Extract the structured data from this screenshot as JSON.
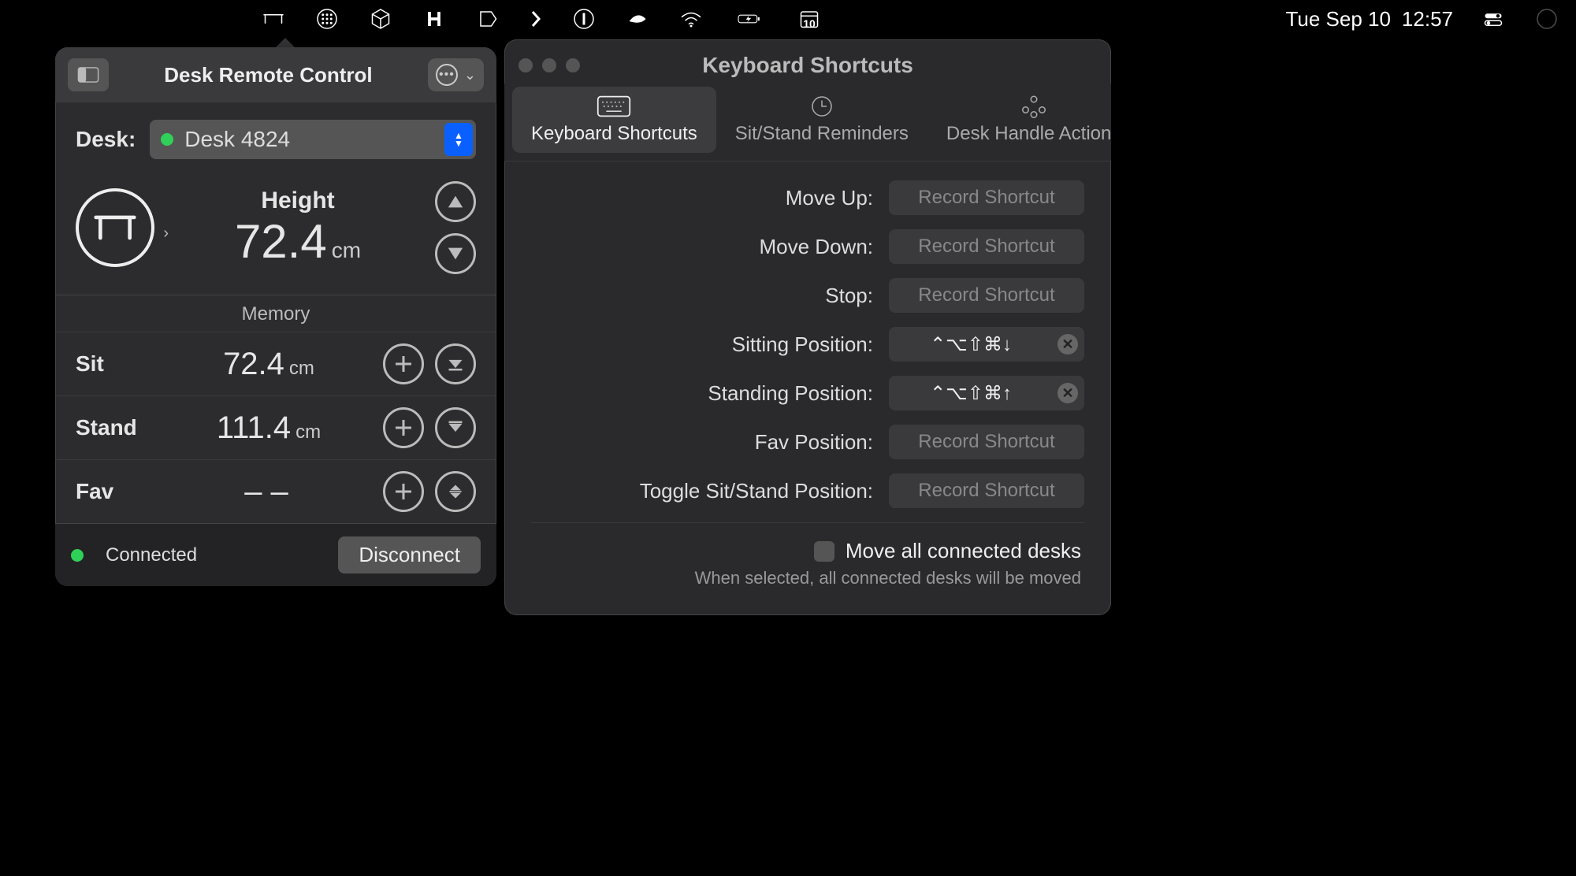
{
  "menubar": {
    "date": "Tue Sep 10",
    "time": "12:57",
    "calendar_badge": "10"
  },
  "popover": {
    "title": "Desk Remote Control",
    "desk_label": "Desk:",
    "desk_name": "Desk 4824",
    "height_label": "Height",
    "height_value": "72.4",
    "height_unit": "cm",
    "memory_title": "Memory",
    "rows": [
      {
        "label": "Sit",
        "value": "72.4",
        "unit": "cm"
      },
      {
        "label": "Stand",
        "value": "111.4",
        "unit": "cm"
      },
      {
        "label": "Fav",
        "value": "– –",
        "unit": ""
      }
    ],
    "connected_label": "Connected",
    "disconnect_label": "Disconnect"
  },
  "kb": {
    "window_title": "Keyboard Shortcuts",
    "tabs": {
      "shortcuts": "Keyboard Shortcuts",
      "reminders": "Sit/Stand Reminders",
      "handle": "Desk Handle Actions"
    },
    "placeholder": "Record Shortcut",
    "rows": [
      {
        "label": "Move Up:",
        "value": "",
        "assigned": false
      },
      {
        "label": "Move Down:",
        "value": "",
        "assigned": false
      },
      {
        "label": "Stop:",
        "value": "",
        "assigned": false
      },
      {
        "label": "Sitting Position:",
        "value": "⌃⌥⇧⌘↓",
        "assigned": true
      },
      {
        "label": "Standing Position:",
        "value": "⌃⌥⇧⌘↑",
        "assigned": true
      },
      {
        "label": "Fav Position:",
        "value": "",
        "assigned": false
      },
      {
        "label": "Toggle Sit/Stand Position:",
        "value": "",
        "assigned": false
      }
    ],
    "move_all_label": "Move all connected desks",
    "move_all_help": "When selected, all connected desks will be moved"
  }
}
